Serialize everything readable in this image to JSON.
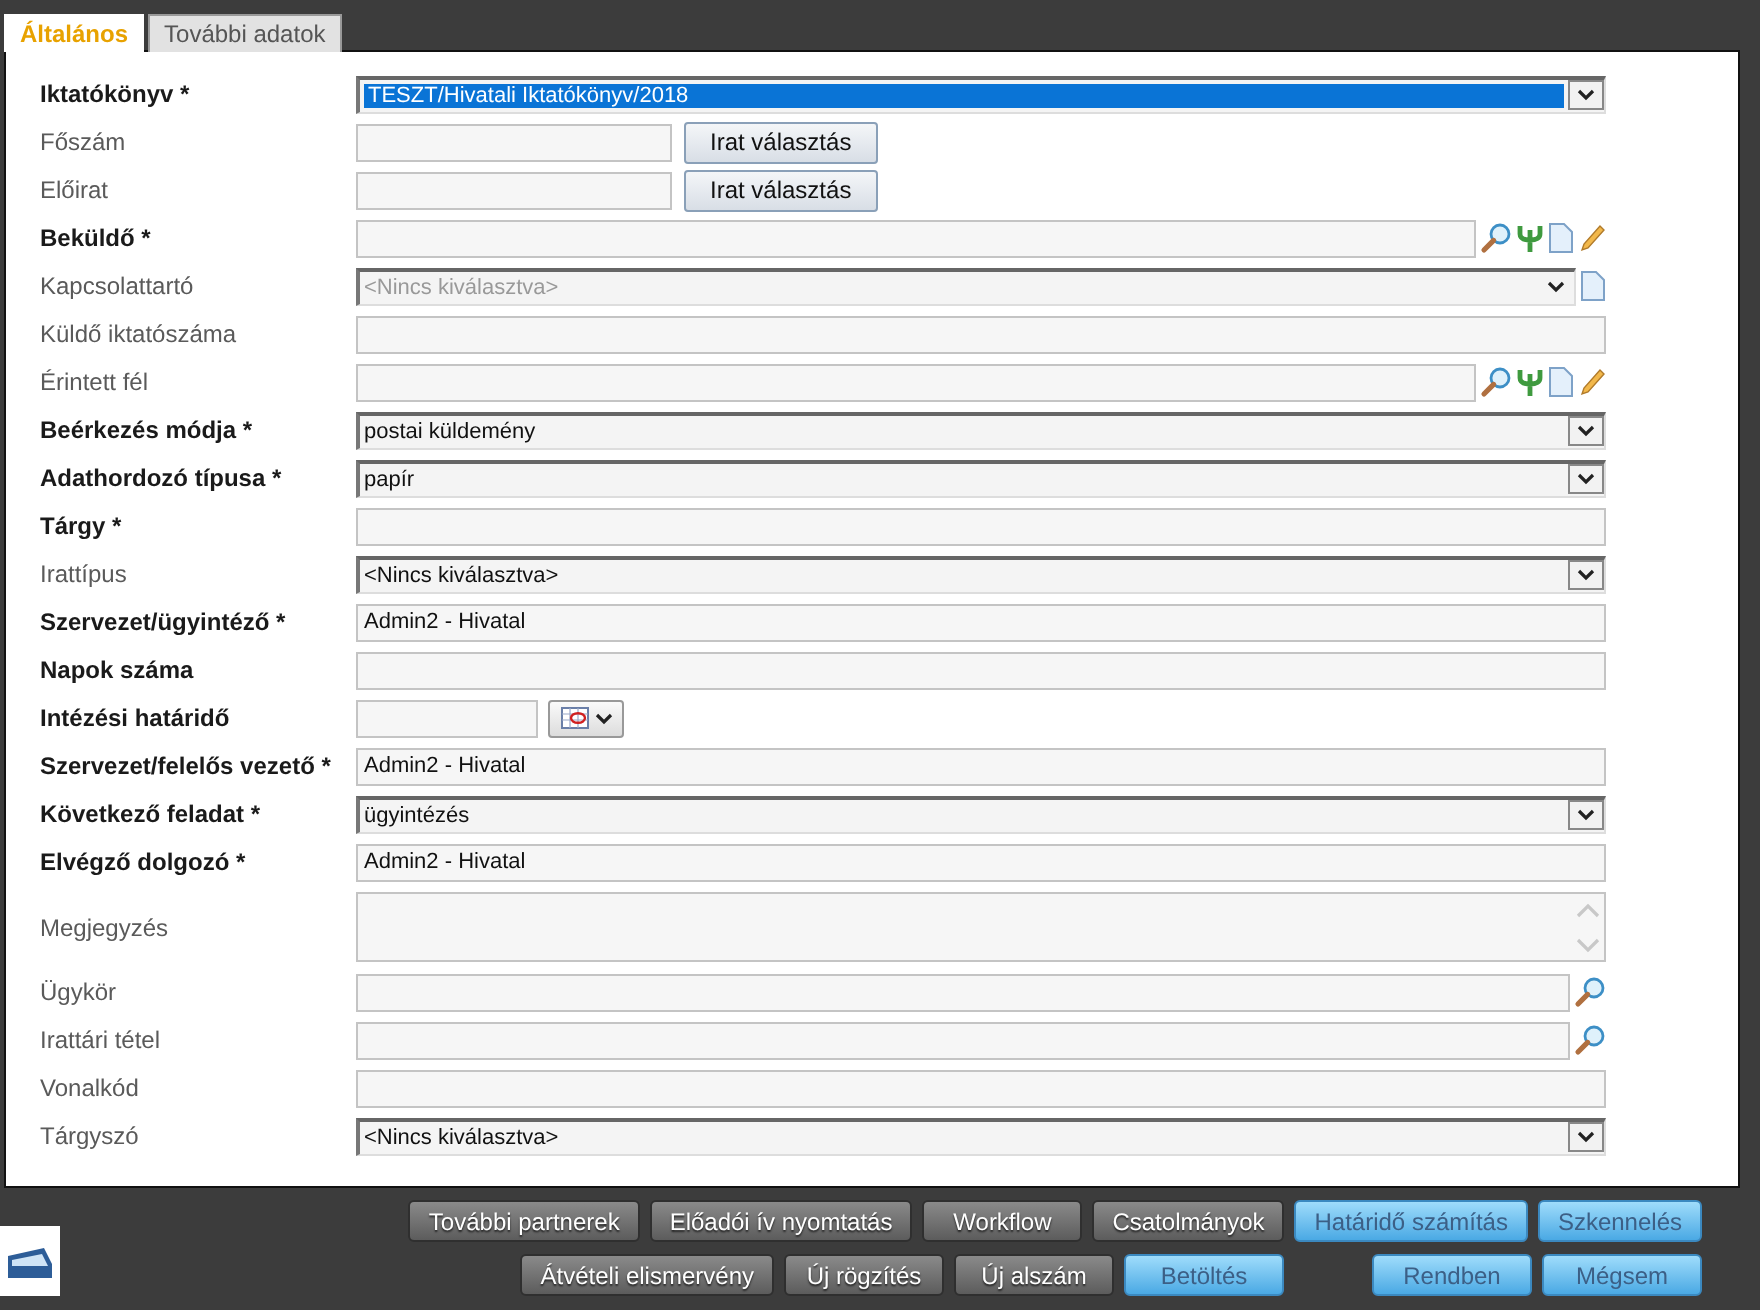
{
  "tabs": [
    {
      "label": "Általános",
      "selected": true
    },
    {
      "label": "További adatok",
      "selected": false
    }
  ],
  "rows": [
    {
      "label": "Iktatókönyv *",
      "emphasized": true,
      "kind": "select",
      "value": "TESZT/Hivatali Iktatókönyv/2018",
      "highlighted": true
    },
    {
      "label": "Főszám",
      "emphasized": false,
      "kind": "text_button",
      "button": "Irat választás"
    },
    {
      "label": "Előirat",
      "emphasized": false,
      "kind": "text_button",
      "button": "Irat választás"
    },
    {
      "label": "Beküldő *",
      "emphasized": true,
      "kind": "lookup"
    },
    {
      "label": "Kapcsolattartó",
      "emphasized": false,
      "kind": "select_doc",
      "value": "<Nincs kiválasztva>",
      "disabled": true
    },
    {
      "label": "Küldő iktatószáma",
      "emphasized": false,
      "kind": "text"
    },
    {
      "label": "Érintett fél",
      "emphasized": false,
      "kind": "lookup"
    },
    {
      "label": "Beérkezés módja *",
      "emphasized": true,
      "kind": "select",
      "value": "postai küldemény"
    },
    {
      "label": "Adathordozó típusa *",
      "emphasized": true,
      "kind": "select",
      "value": "papír"
    },
    {
      "label": "Tárgy *",
      "emphasized": true,
      "kind": "text"
    },
    {
      "label": "Irattípus",
      "emphasized": false,
      "kind": "select",
      "value": "<Nincs kiválasztva>"
    },
    {
      "label": "Szervezet/ügyintéző *",
      "emphasized": true,
      "kind": "text",
      "value": "Admin2 - Hivatal"
    },
    {
      "label": "Napok száma",
      "emphasized": true,
      "kind": "text"
    },
    {
      "label": "Intézési határidő",
      "emphasized": true,
      "kind": "date"
    },
    {
      "label": "Szervezet/felelős vezető *",
      "emphasized": true,
      "kind": "text",
      "value": "Admin2 - Hivatal"
    },
    {
      "label": "Következő feladat *",
      "emphasized": true,
      "kind": "select",
      "value": "ügyintézés"
    },
    {
      "label": "Elvégző dolgozó *",
      "emphasized": true,
      "kind": "text",
      "value": "Admin2 - Hivatal"
    },
    {
      "label": "Megjegyzés",
      "emphasized": false,
      "kind": "textarea"
    },
    {
      "label": "Ügykör",
      "emphasized": false,
      "kind": "search"
    },
    {
      "label": "Irattári tétel",
      "emphasized": false,
      "kind": "search"
    },
    {
      "label": "Vonalkód",
      "emphasized": false,
      "kind": "text"
    },
    {
      "label": "Tárgyszó",
      "emphasized": false,
      "kind": "select",
      "value": "<Nincs kiválasztva>"
    }
  ],
  "button_rows": [
    {
      "groups": [
        [
          {
            "label": "További partnerek",
            "kind": "secondary"
          },
          {
            "label": "Előadói ív nyomtatás",
            "kind": "secondary"
          },
          {
            "label": "Workflow",
            "kind": "secondary"
          },
          {
            "label": "Csatolmányok",
            "kind": "secondary"
          },
          {
            "label": "Határidő számítás",
            "kind": "primary"
          },
          {
            "label": "Szkennelés",
            "kind": "primary"
          }
        ]
      ]
    },
    {
      "groups": [
        [
          {
            "label": "Átvételi elismervény",
            "kind": "secondary"
          },
          {
            "label": "Új rögzítés",
            "kind": "secondary"
          },
          {
            "label": "Új alszám",
            "kind": "secondary"
          },
          {
            "label": "Betöltés",
            "kind": "primary"
          }
        ],
        [
          {
            "label": "Rendben",
            "kind": "primary"
          },
          {
            "label": "Mégsem",
            "kind": "primary"
          }
        ]
      ]
    }
  ]
}
